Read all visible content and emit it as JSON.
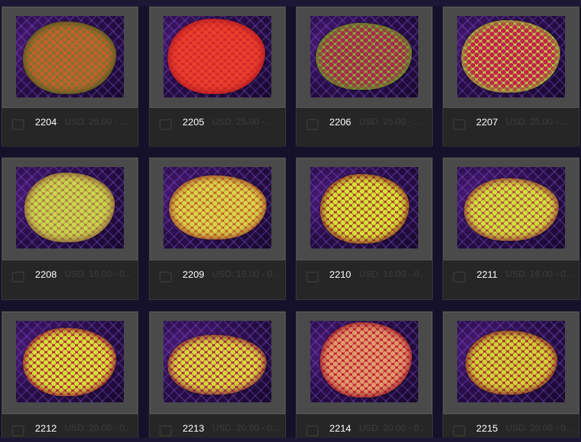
{
  "products": [
    {
      "sku": "2204",
      "price": "USD. 25.00 - ...",
      "coral": {
        "base": "#6b7a2e",
        "spot": "#c4602c",
        "edge": "#4d5a20"
      }
    },
    {
      "sku": "2205",
      "price": "USD. 25.00 - ...",
      "coral": {
        "base": "#d4242a",
        "spot": "#e8402c",
        "edge": "#b11a22"
      }
    },
    {
      "sku": "2206",
      "price": "USD. 25.00 - ...",
      "coral": {
        "base": "#7fb63a",
        "spot": "#a82a4a",
        "edge": "#5e8c26"
      }
    },
    {
      "sku": "2207",
      "price": "USD. 25.00 - ...",
      "coral": {
        "base": "#b9d24a",
        "spot": "#c4224a",
        "edge": "#8aa636"
      }
    },
    {
      "sku": "2208",
      "price": "USD. 16.00 - 0...",
      "coral": {
        "base": "#b07a4a",
        "spot": "#c8d64a",
        "edge": "#8a5a3a"
      }
    },
    {
      "sku": "2209",
      "price": "USD. 16.00 - 0...",
      "coral": {
        "base": "#c4602a",
        "spot": "#d8d44a",
        "edge": "#a0482a"
      }
    },
    {
      "sku": "2210",
      "price": "USD. 16.00 - 0...",
      "coral": {
        "base": "#a83a2e",
        "spot": "#d6e238",
        "edge": "#862c26"
      }
    },
    {
      "sku": "2211",
      "price": "USD. 16.00 - 0...",
      "coral": {
        "base": "#b44a4a",
        "spot": "#d0e03a",
        "edge": "#8e3636"
      }
    },
    {
      "sku": "2212",
      "price": "USD. 20.00 - 0...",
      "coral": {
        "base": "#b8243a",
        "spot": "#d4e23a",
        "edge": "#941c30"
      }
    },
    {
      "sku": "2213",
      "price": "USD. 20.00 - 0...",
      "coral": {
        "base": "#a8284a",
        "spot": "#d8d83a",
        "edge": "#841f3a"
      }
    },
    {
      "sku": "2214",
      "price": "USD. 20.00 - 0...",
      "coral": {
        "base": "#c01e34",
        "spot": "#e09a6a",
        "edge": "#9a182a"
      }
    },
    {
      "sku": "2215",
      "price": "USD. 20.00 - 0...",
      "coral": {
        "base": "#a8322e",
        "spot": "#d2d23a",
        "edge": "#86282a"
      }
    }
  ]
}
